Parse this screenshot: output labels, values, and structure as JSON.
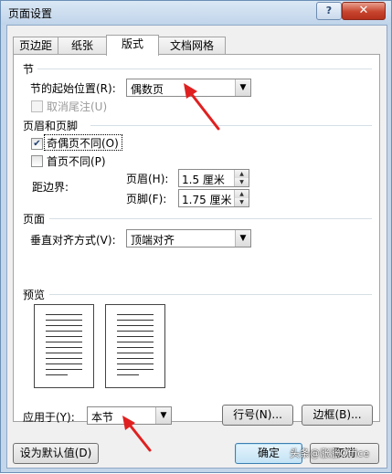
{
  "window": {
    "title": "页面设置",
    "help_glyph": "?",
    "close_glyph": "✕"
  },
  "tabs": [
    {
      "label": "页边距"
    },
    {
      "label": "纸张"
    },
    {
      "label": "版式"
    },
    {
      "label": "文档网格"
    }
  ],
  "section": {
    "title": "节",
    "start_label": "节的起始位置(R):",
    "start_value": "偶数页",
    "suppress_endnotes_label": "取消尾注(U)",
    "suppress_endnotes_checked": false
  },
  "headers_footers": {
    "title": "页眉和页脚",
    "odd_even_label": "奇偶页不同(O)",
    "odd_even_checked": true,
    "first_page_label": "首页不同(P)",
    "first_page_checked": false,
    "distance_label": "距边界:",
    "header_label": "页眉(H):",
    "header_value": "1.5 厘米",
    "footer_label": "页脚(F):",
    "footer_value": "1.75 厘米"
  },
  "page": {
    "title": "页面",
    "valign_label": "垂直对齐方式(V):",
    "valign_value": "顶端对齐"
  },
  "preview": {
    "title": "预览"
  },
  "apply": {
    "label": "应用于(Y):",
    "value": "本节",
    "line_numbers_button": "行号(N)...",
    "borders_button": "边框(B)..."
  },
  "footer_buttons": {
    "set_default": "设为默认值(D)",
    "ok": "确定",
    "cancel": "取消"
  },
  "watermark": "头条@涨涨Office",
  "colors": {
    "accent_arrow": "#e02020",
    "title_bar": "#c4d6ea"
  }
}
